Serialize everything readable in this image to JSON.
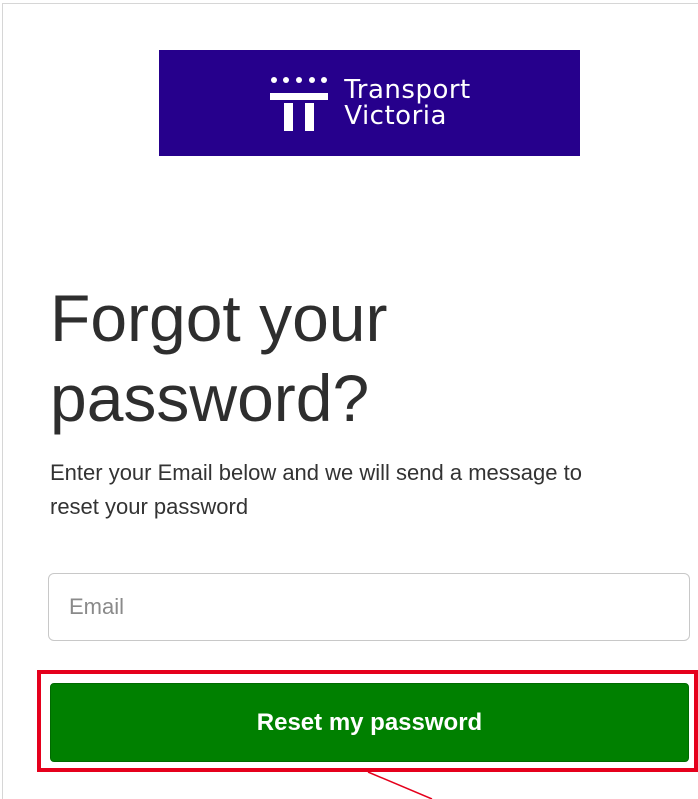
{
  "brand": {
    "line1": "Transport",
    "line2": "Victoria",
    "background_color": "#26008c",
    "logo_icon": "transport-victoria-t-mark"
  },
  "form": {
    "title_line1": "Forgot your",
    "title_line2": "password?",
    "description": "Enter your Email below and we will send a message to reset your password",
    "email_placeholder": "Email",
    "email_value": "",
    "submit_label": "Reset my password",
    "submit_color": "#008000"
  },
  "annotation": {
    "highlight_color": "#e5001c"
  }
}
